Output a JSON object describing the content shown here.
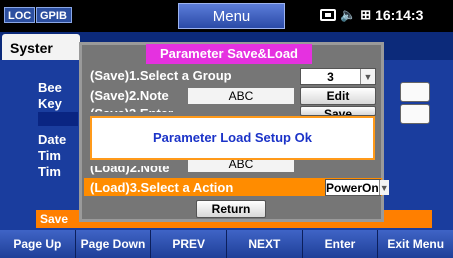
{
  "statusbar": {
    "loc": "LOC",
    "gpib": "GPIB",
    "menu_title": "Menu",
    "time": "16:14:3"
  },
  "background": {
    "tab_system": "Syster",
    "labels": [
      "Bee",
      "Key",
      "Date",
      "Tim",
      "Tim"
    ],
    "save_label": "Save"
  },
  "dialog": {
    "title": "Parameter Save&Load",
    "save_group_label": "(Save)1.Select a Group",
    "save_group_value": "3",
    "save_note_label": "(Save)2.Note",
    "save_note_value": "ABC",
    "edit_label": "Edit",
    "save_enter_label": "(Save)3.Enter",
    "save_button_label": "Save",
    "load_note_label": "(Load)2.Note",
    "load_note_value": "ABC",
    "load_action_label": "(Load)3.Select a Action",
    "load_action_value": "PowerOn",
    "return_label": "Return"
  },
  "message": {
    "text": "Parameter Load Setup Ok"
  },
  "softkeys": [
    "Page Up",
    "Page Down",
    "PREV",
    "NEXT",
    "Enter",
    "Exit Menu"
  ]
}
